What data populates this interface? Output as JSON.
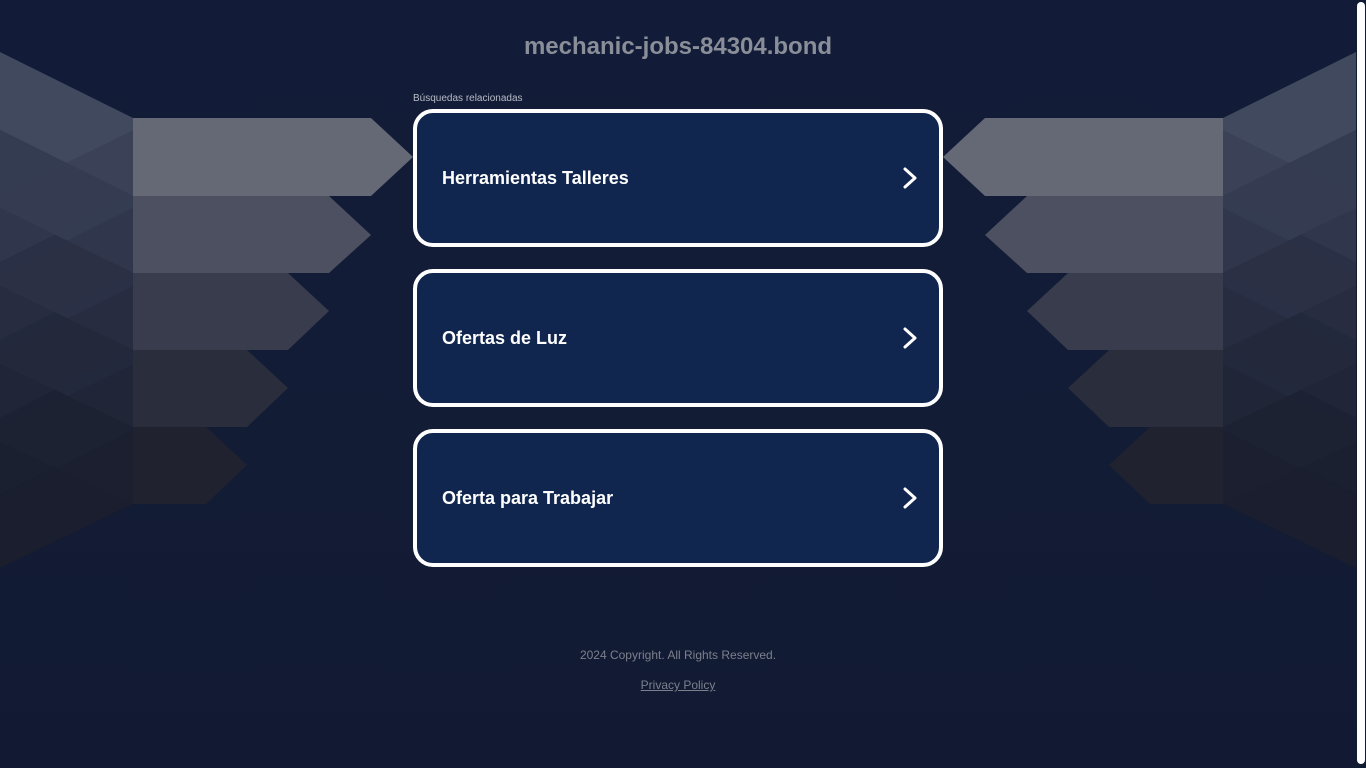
{
  "header": {
    "site_title": "mechanic-jobs-84304.bond"
  },
  "related": {
    "label": "Búsquedas relacionadas",
    "links": [
      {
        "label": "Herramientas Talleres",
        "icon": "chevron-right-icon"
      },
      {
        "label": "Ofertas de Luz",
        "icon": "chevron-right-icon"
      },
      {
        "label": "Oferta para Trabajar",
        "icon": "chevron-right-icon"
      }
    ]
  },
  "footer": {
    "copyright": "2024 Copyright. All Rights Reserved.",
    "privacy_label": "Privacy Policy"
  },
  "colors": {
    "background": "#121b34",
    "card_background": "#11264f",
    "card_border": "#ffffff",
    "title_text": "#8a8e98",
    "footer_text": "#7b808c"
  }
}
